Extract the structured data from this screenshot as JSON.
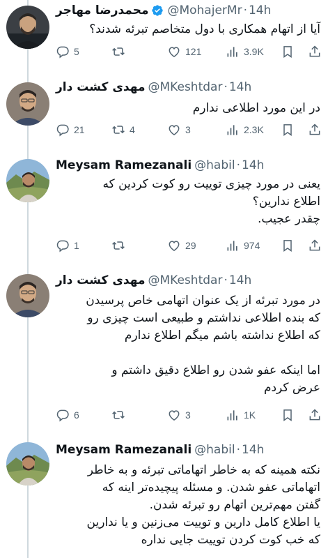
{
  "tweets": [
    {
      "name": "محمدرضا مهاجر",
      "verified": true,
      "handle": "@MohajerMr",
      "time": "14h",
      "lines": [
        "آیا از اتهام همکاری با دول متخاصم تبرئه شدند؟"
      ],
      "replies": "5",
      "retweets": "",
      "likes": "121",
      "views": "3.9K"
    },
    {
      "name": "مهدی کشت دار",
      "verified": false,
      "handle": "@MKeshtdar",
      "time": "14h",
      "lines": [
        "در این مورد اطلاعی ندارم"
      ],
      "replies": "21",
      "retweets": "4",
      "likes": "3",
      "views": "2.3K"
    },
    {
      "name": "Meysam Ramezanali",
      "verified": false,
      "handle": "@habil",
      "time": "14h",
      "lines": [
        "یعنی در مورد چیزی توییت رو کوت کردین که",
        "اطلاع ندارین؟",
        "چقدر عجیب."
      ],
      "replies": "1",
      "retweets": "",
      "likes": "29",
      "views": "974"
    },
    {
      "name": "مهدی کشت دار",
      "verified": false,
      "handle": "@MKeshtdar",
      "time": "14h",
      "lines": [
        "در مورد تبرئه از یک عنوان اتهامی خاص پرسیدن",
        "که بنده اطلاعی نداشتم و طبیعی است چیزی رو",
        "که اطلاع نداشته باشم میگم اطلاع ندارم",
        "",
        "اما اینکه عفو شدن رو اطلاع دقیق داشتم و",
        "عرض کردم"
      ],
      "replies": "6",
      "retweets": "",
      "likes": "3",
      "views": "1K"
    },
    {
      "name": "Meysam Ramezanali",
      "verified": false,
      "handle": "@habil",
      "time": "14h",
      "lines": [
        "نکته همینه که به خاطر اتهاماتی تبرئه و به خاطر",
        "اتهاماتی عفو شدن. و مسئله پیچیده‌تر اینه که",
        "گفتن مهم‌ترین اتهام رو تبرئه شدن.",
        "یا اطلاع کامل دارین و توییت می‌زنین و یا ندارین",
        "که خب کوت کردن توییت جایی نداره"
      ]
    }
  ],
  "colors": {
    "text": "#0f1419",
    "secondary": "#536471",
    "verified": "#1d9bf0",
    "thread_line": "#cfd9de"
  }
}
